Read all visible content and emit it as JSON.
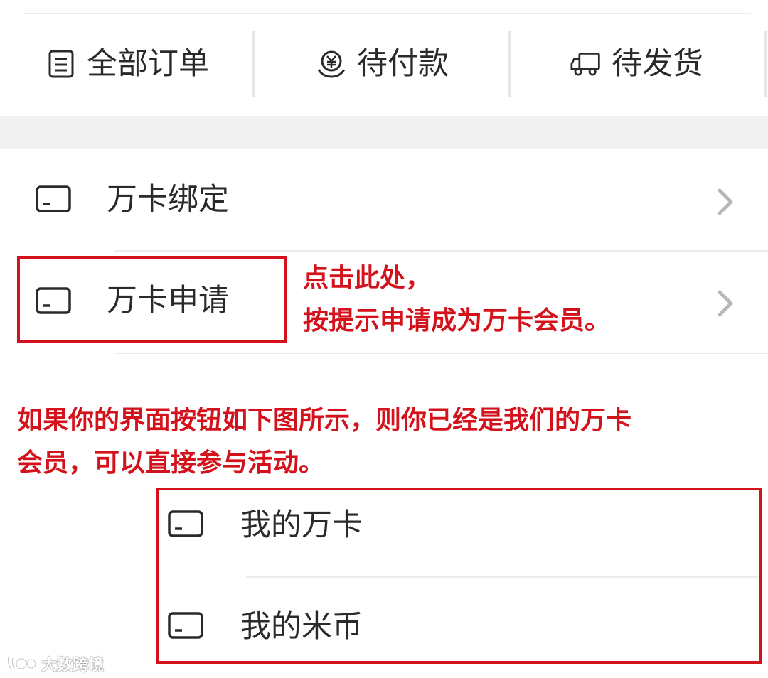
{
  "orders": {
    "all_label": "全部订单",
    "pending_pay_label": "待付款",
    "pending_ship_label": "待发货"
  },
  "menu": {
    "bind_label": "万卡绑定",
    "apply_label": "万卡申请"
  },
  "annotations": {
    "apply_hint": "点击此处，\n按提示申请成为万卡会员。",
    "member_hint": "如果你的界面按钮如下图所示，则你已经是我们的万卡\n会员，可以直接参与活动。"
  },
  "member_menu": {
    "my_card_label": "我的万卡",
    "my_coins_label": "我的米币"
  },
  "watermark": {
    "text": "大数跨境"
  },
  "colors": {
    "annotation_red": "#d3121b",
    "band_gray": "#f1f1f1",
    "divider": "#ececec"
  }
}
